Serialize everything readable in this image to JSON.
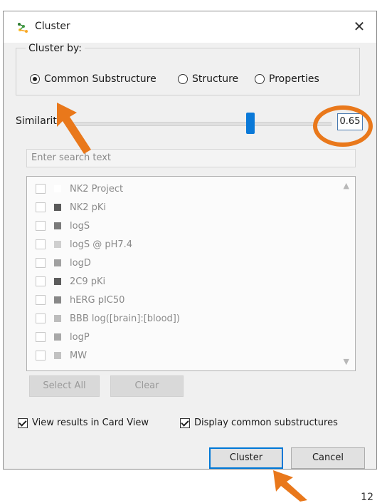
{
  "window": {
    "title": "Cluster",
    "close_glyph": "✕"
  },
  "cluster_by": {
    "label": "Cluster by:",
    "options": [
      "Common Substructure",
      "Structure",
      "Properties"
    ],
    "selected_index": 0
  },
  "similarity": {
    "label": "Similarit",
    "value": "0.65",
    "level": 0.65
  },
  "search": {
    "placeholder": "Enter search text"
  },
  "properties": {
    "items": [
      {
        "label": "NK2 Project",
        "swatch": "#ffffff"
      },
      {
        "label": "NK2 pKi",
        "swatch": "#5a5a5a"
      },
      {
        "label": "logS",
        "swatch": "#7a7a7a"
      },
      {
        "label": "logS @ pH7.4",
        "swatch": "#cfcfcf"
      },
      {
        "label": "logD",
        "swatch": "#a0a0a0"
      },
      {
        "label": "2C9 pKi",
        "swatch": "#5c5c5c"
      },
      {
        "label": "hERG pIC50",
        "swatch": "#888888"
      },
      {
        "label": "BBB log([brain]:[blood])",
        "swatch": "#bdbdbd"
      },
      {
        "label": "logP",
        "swatch": "#a8a8a8"
      },
      {
        "label": "MW",
        "swatch": "#c2c2c2"
      }
    ]
  },
  "list_buttons": {
    "select_all": "Select All",
    "clear": "Clear"
  },
  "options": {
    "card_view": "View results in Card View",
    "display_common": "Display common substructures"
  },
  "buttons": {
    "cluster": "Cluster",
    "cancel": "Cancel"
  },
  "page_number": "12",
  "colors": {
    "accent": "#0078d7",
    "highlight": "#e9781b"
  },
  "icons": {
    "app": "cluster-app-icon",
    "close": "close-icon"
  }
}
